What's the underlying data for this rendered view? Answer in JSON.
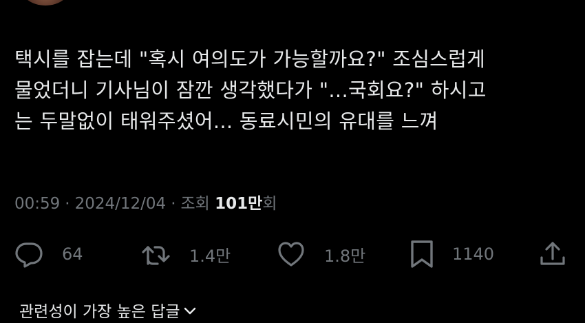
{
  "tweet": {
    "text_lines": [
      "택시를 잡는데 \"혹시 여의도가 가능할까요?\" 조심스럽게",
      "물었더니 기사님이 잠깐 생각했다가 \"...국회요?\" 하시고",
      "는 두말없이 태워주셨어... 동료시민의 유대를 느껴"
    ],
    "time": "00:59",
    "separator": "·",
    "date": "2024/12/04",
    "views_label": "조회",
    "views_count": "101만",
    "views_suffix": "회"
  },
  "actions": {
    "reply": {
      "icon": "reply-icon",
      "count": "64"
    },
    "retweet": {
      "icon": "retweet-icon",
      "count": "1.4만"
    },
    "like": {
      "icon": "heart-icon",
      "count": "1.8만"
    },
    "bookmark": {
      "icon": "bookmark-icon",
      "count": "1140"
    },
    "share": {
      "icon": "share-icon"
    }
  },
  "replies_sort": {
    "label": "관련성이 가장 높은 답글",
    "icon": "chevron-down-icon"
  },
  "colors": {
    "background": "#000000",
    "text": "#e7e9ea",
    "secondary": "#71767b"
  }
}
